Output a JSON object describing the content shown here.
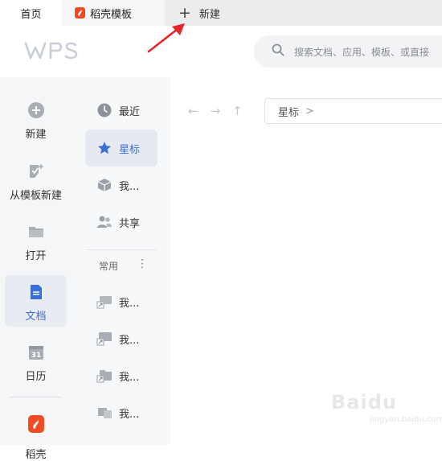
{
  "tabs": {
    "home": "首页",
    "template": "稻壳模板",
    "new_tab": "新建"
  },
  "header": {
    "logo": "WPS",
    "search_placeholder": "搜索文档、应用、模板、或直接"
  },
  "left_nav": {
    "items": [
      {
        "label": "新建",
        "icon": "plus-circle-icon"
      },
      {
        "label": "从模板新建",
        "icon": "template-plus-icon"
      },
      {
        "label": "打开",
        "icon": "folder-icon"
      },
      {
        "label": "文档",
        "icon": "document-icon",
        "active": true
      },
      {
        "label": "日历",
        "icon": "calendar-icon"
      },
      {
        "label": "稻壳",
        "icon": "docer-icon"
      }
    ]
  },
  "sec_nav": {
    "items": [
      {
        "label": "最近",
        "icon": "clock-icon"
      },
      {
        "label": "星标",
        "icon": "star-icon",
        "active": true
      },
      {
        "label": "我...",
        "icon": "box-icon"
      },
      {
        "label": "共享",
        "icon": "people-icon"
      }
    ],
    "group_label": "常用",
    "group_more": "⋮",
    "shortcuts": [
      {
        "label": "我...",
        "icon": "shortcut-desktop-icon"
      },
      {
        "label": "我...",
        "icon": "shortcut-computer-icon"
      },
      {
        "label": "我...",
        "icon": "shortcut-folder-icon"
      },
      {
        "label": "我...",
        "icon": "shortcut-device-icon"
      }
    ]
  },
  "main": {
    "path_label": "星标",
    "path_chevron": ">"
  },
  "watermark": {
    "text": "Baidu",
    "sub": "jingyan.baidu.com"
  },
  "colors": {
    "accent": "#3b6fd8",
    "arrow": "#e2262a",
    "docer": "#f04b23"
  }
}
